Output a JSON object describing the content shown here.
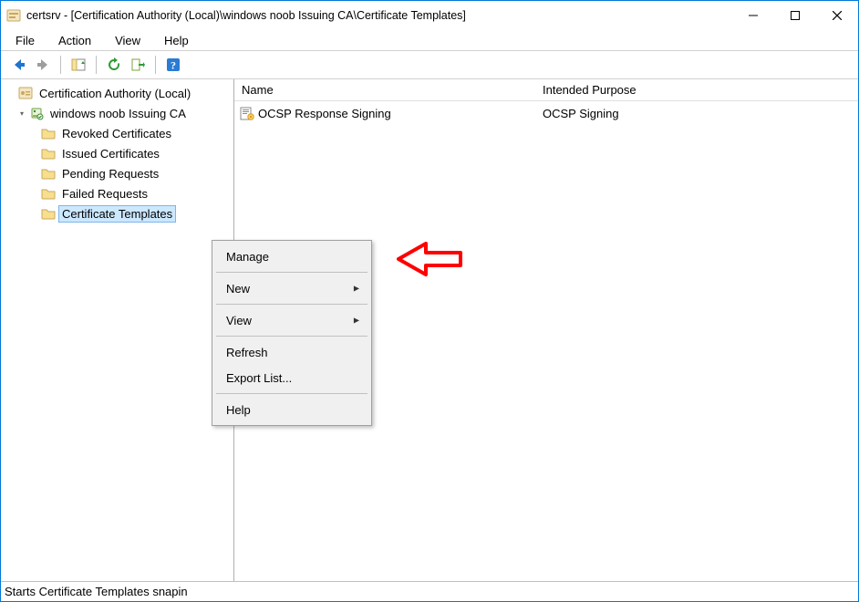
{
  "window": {
    "title": "certsrv - [Certification Authority (Local)\\windows noob Issuing CA\\Certificate Templates]"
  },
  "menubar": {
    "file": "File",
    "action": "Action",
    "view": "View",
    "help": "Help"
  },
  "tree": {
    "root_label": "Certification Authority (Local)",
    "ca_label": "windows noob Issuing CA",
    "children": [
      "Revoked Certificates",
      "Issued Certificates",
      "Pending Requests",
      "Failed Requests",
      "Certificate Templates"
    ],
    "selected_index": 4
  },
  "list": {
    "columns": {
      "name": "Name",
      "purpose": "Intended Purpose"
    },
    "rows": [
      {
        "name": "OCSP Response Signing",
        "purpose": "OCSP Signing"
      }
    ]
  },
  "context_menu": {
    "items": [
      {
        "label": "Manage",
        "type": "item"
      },
      {
        "type": "sep"
      },
      {
        "label": "New",
        "type": "submenu"
      },
      {
        "type": "sep"
      },
      {
        "label": "View",
        "type": "submenu"
      },
      {
        "type": "sep"
      },
      {
        "label": "Refresh",
        "type": "item"
      },
      {
        "label": "Export List...",
        "type": "item"
      },
      {
        "type": "sep"
      },
      {
        "label": "Help",
        "type": "item"
      }
    ]
  },
  "statusbar": {
    "text": "Starts Certificate Templates snapin"
  },
  "colors": {
    "selection_bg": "#cce8ff",
    "selection_border": "#7eb4ea",
    "window_border": "#0078d7",
    "annotation": "#ff0000"
  }
}
